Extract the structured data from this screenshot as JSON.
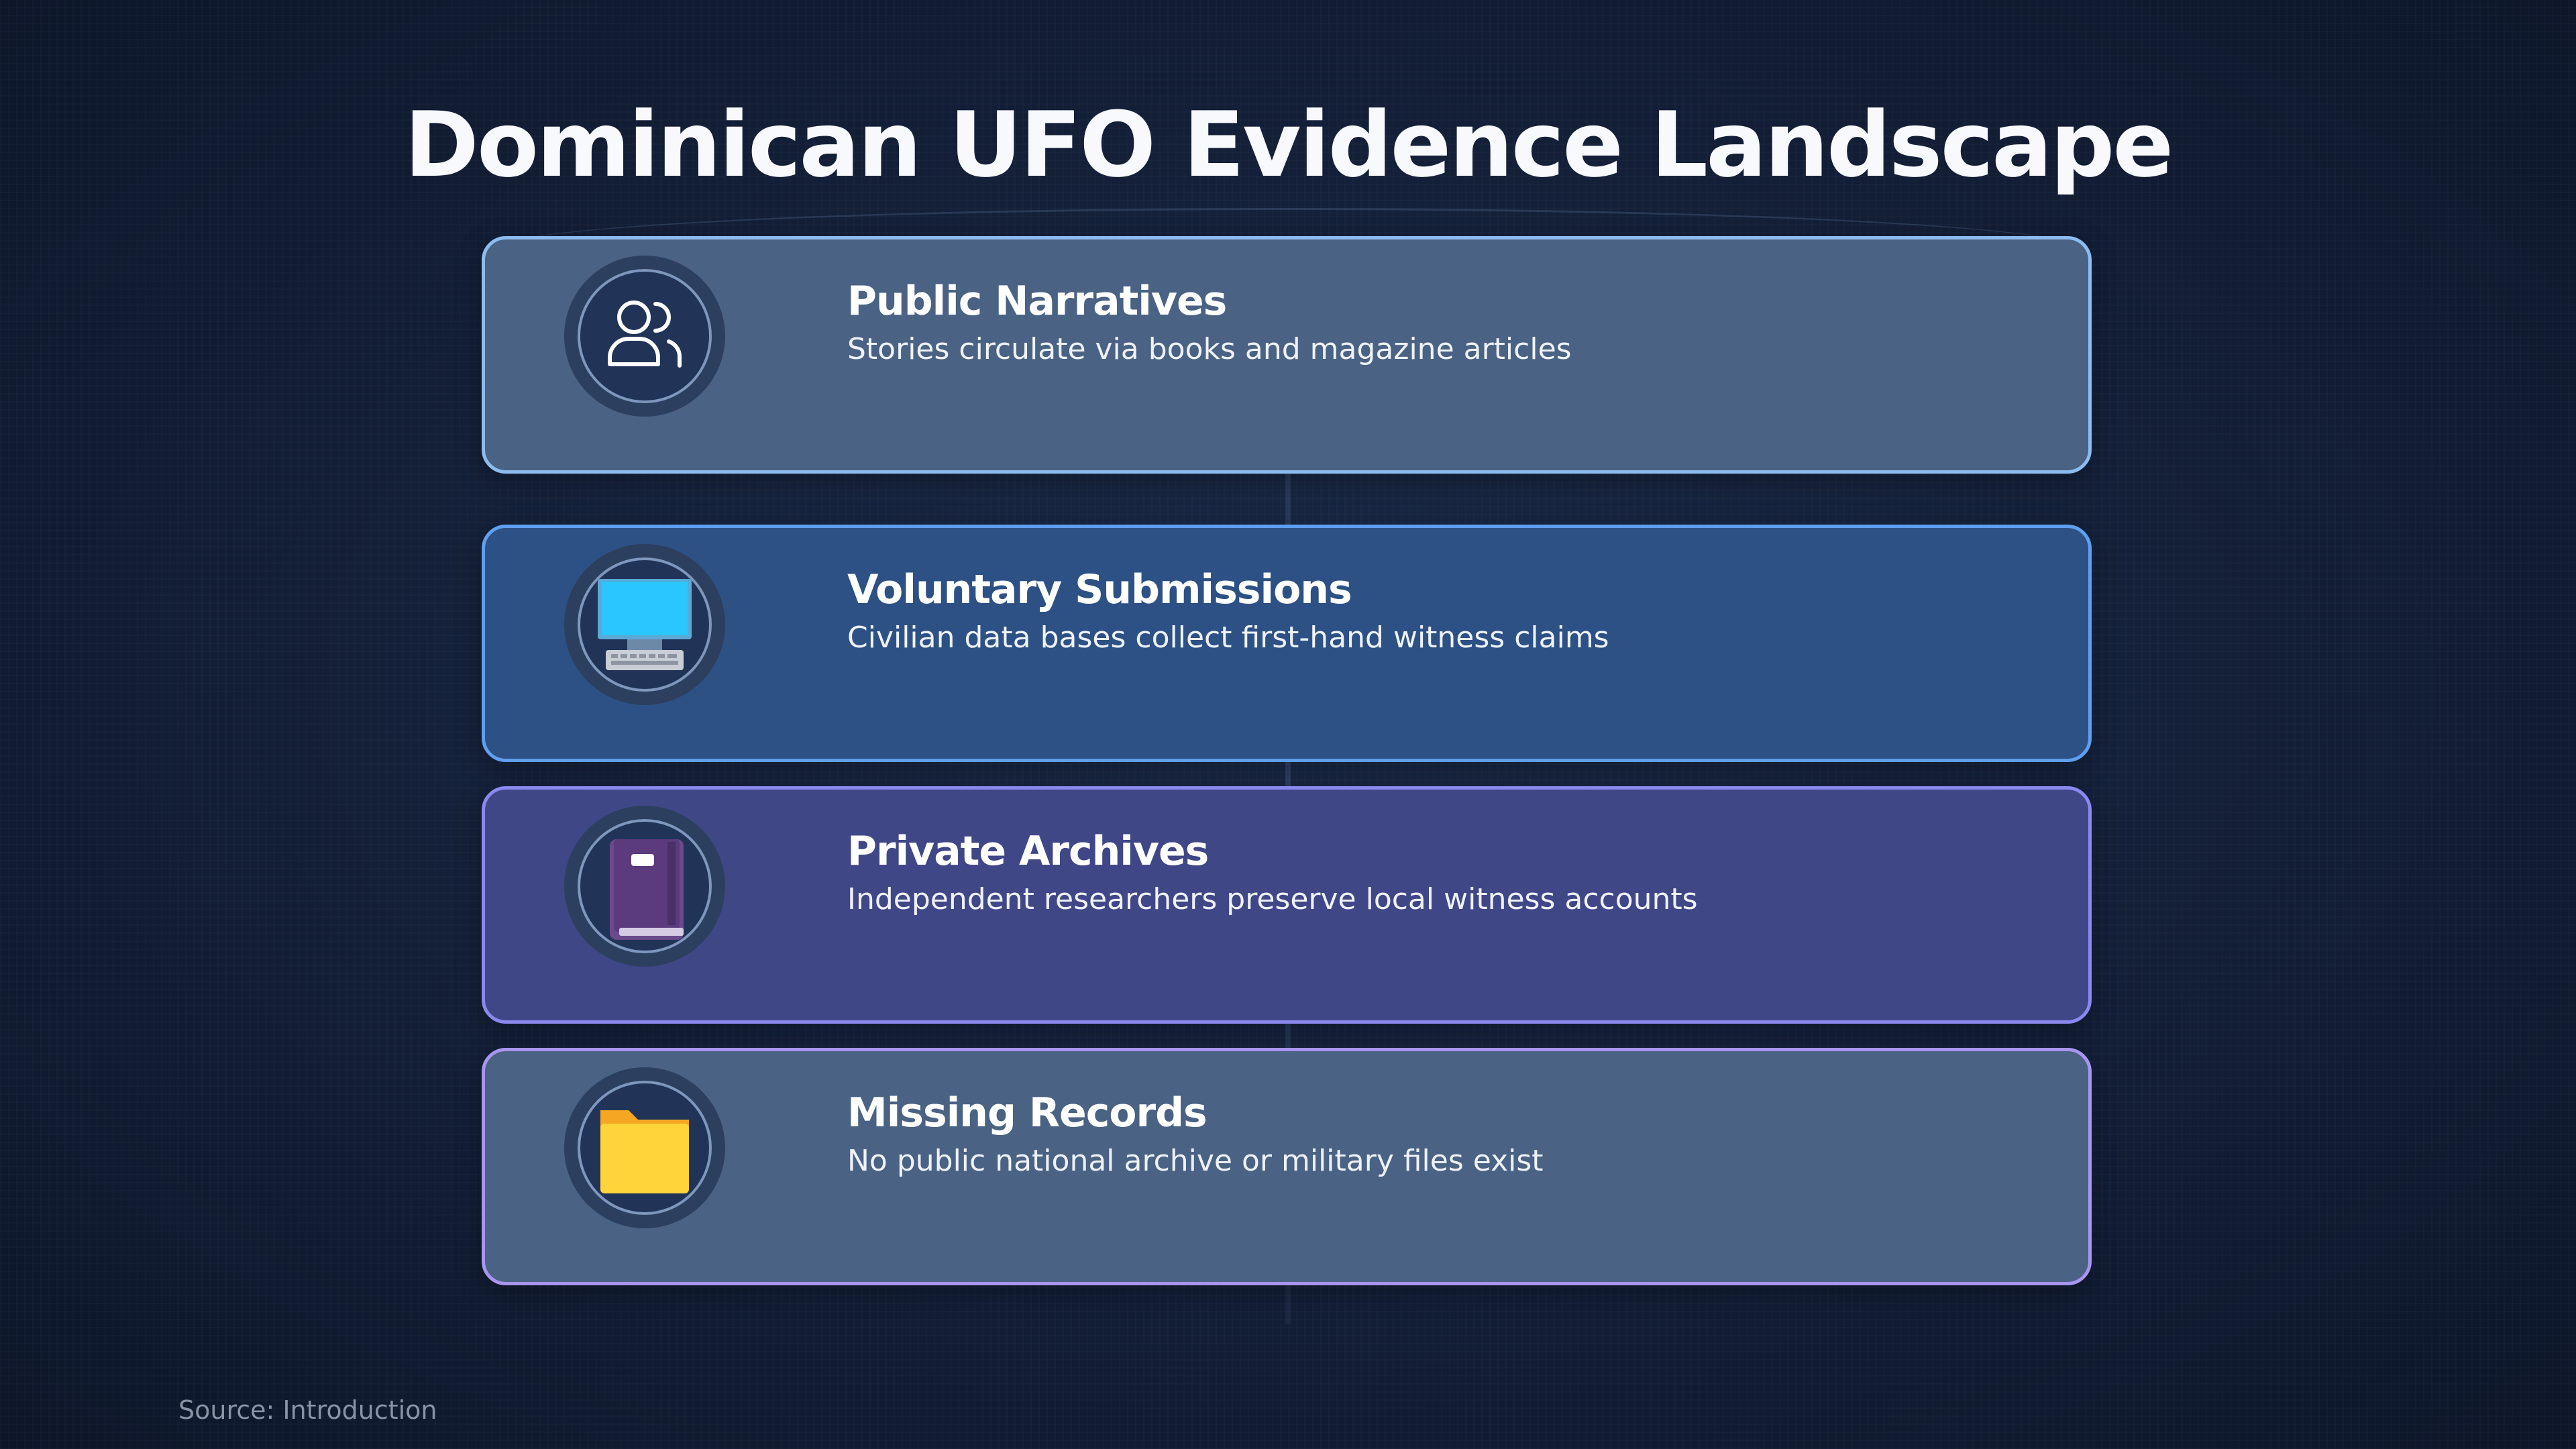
{
  "title": "Dominican UFO Evidence Landscape",
  "cards": [
    {
      "icon": "people-icon",
      "title": "Public Narratives",
      "description": "Stories circulate via books and magazine articles"
    },
    {
      "icon": "computer-icon",
      "title": "Voluntary Submissions",
      "description": "Civilian data bases collect first-hand witness claims"
    },
    {
      "icon": "book-icon",
      "title": "Private Archives",
      "description": "Independent researchers preserve local witness accounts"
    },
    {
      "icon": "folder-icon",
      "title": "Missing Records",
      "description": "No public national archive or military files exist"
    }
  ],
  "source": "Source: Introduction",
  "colors": {
    "background": "#14213a",
    "card_1": "#4a6283",
    "card_2": "#2d5185",
    "card_3": "#404787",
    "card_4": "#4a6283"
  }
}
